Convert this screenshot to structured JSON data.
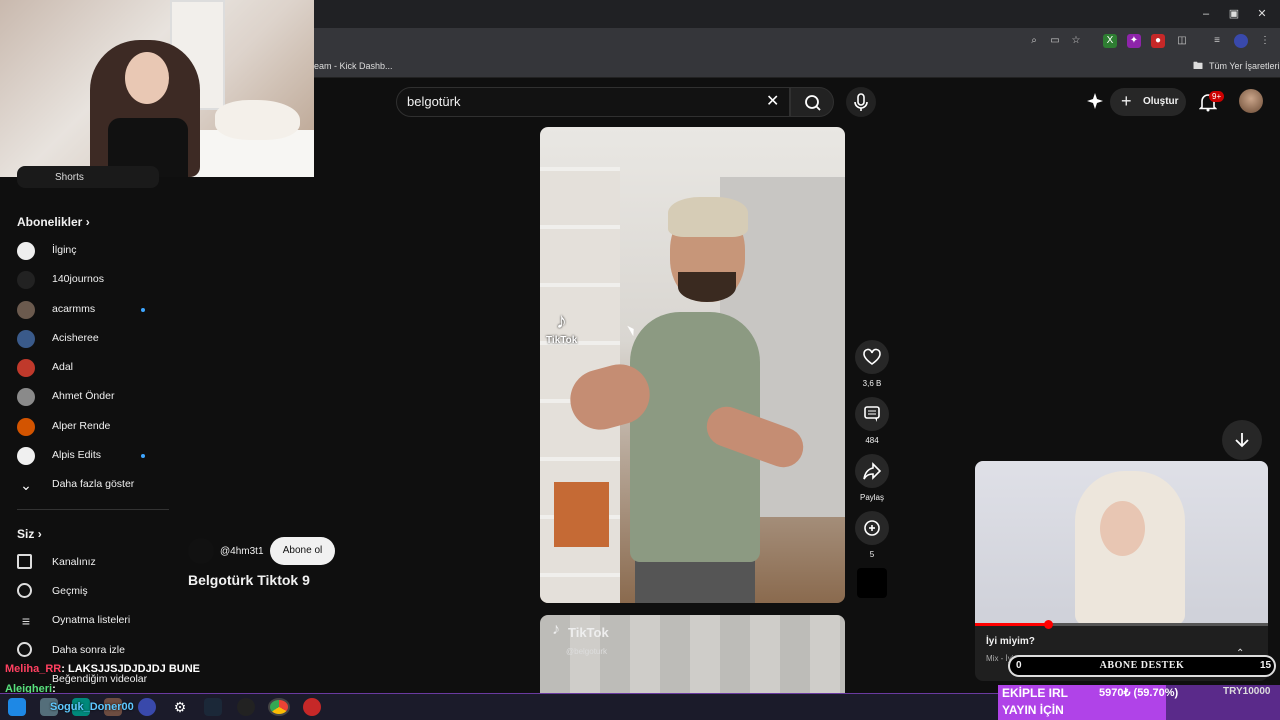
{
  "browser": {
    "bookmark_partial": "eam - Kick Dashb...",
    "all_bookmarks": "Tüm Yer İşaretleri"
  },
  "header": {
    "search_query": "belgotürk",
    "create_label": "Oluştur",
    "notifications_badge": "9+"
  },
  "sidebar": {
    "partial_item": "Shorts",
    "subscriptions_heading": "Abonelikler",
    "subscriptions": [
      {
        "label": "İlginç",
        "new": false,
        "color": "#eeeeee"
      },
      {
        "label": "140journos",
        "new": false,
        "color": "#222222"
      },
      {
        "label": "acarmms",
        "new": true,
        "color": "#6b5a4e"
      },
      {
        "label": "Acisheree",
        "new": false,
        "color": "#3a5a8a"
      },
      {
        "label": "Adal",
        "new": false,
        "color": "#c0392b"
      },
      {
        "label": "Ahmet Önder",
        "new": false,
        "color": "#8a8a8a"
      },
      {
        "label": "Alper Rende",
        "new": false,
        "color": "#d35400"
      },
      {
        "label": "Alpis Edits",
        "new": true,
        "color": "#f0f0f0"
      }
    ],
    "show_more": "Daha fazla göster",
    "you_heading": "Siz",
    "you_items": [
      {
        "label": "Kanalınız"
      },
      {
        "label": "Geçmiş"
      },
      {
        "label": "Oynatma listeleri"
      },
      {
        "label": "Daha sonra izle"
      },
      {
        "label": "Beğendiğim videolar"
      }
    ]
  },
  "short": {
    "channel_handle": "@4hm3t1",
    "subscribe_label": "Abone ol",
    "title": "Belgotürk Tiktok 9",
    "watermark": "TikTok",
    "likes": "3,6 B",
    "comments": "484",
    "share_label": "Paylaş",
    "remix_count": "5"
  },
  "next_short": {
    "watermark": "TikTok",
    "handle": "@belgoturk"
  },
  "mini_player": {
    "title": "İyi miyim?",
    "subtitle": "Mix - İyi miyim?",
    "progress": 0.25
  },
  "overlay": {
    "abone_left": "0",
    "abone_label": "ABONE DESTEK",
    "abone_right": "15",
    "chat": [
      {
        "user": "Meliha_RR",
        "message": ": LAKSJJSJDJDJDJ BUNE"
      },
      {
        "user": "Aleigheri",
        "message": ":"
      }
    ],
    "donation_line1": "EKİPLE IRL",
    "donation_line2": "YAYIN İÇİN",
    "donation_progress": "5970₺ (59.70%)",
    "donation_fraction": 0.597,
    "donation_goal": "TRY10000",
    "taskbar_user": "Soguk_Doner00"
  },
  "colors": {
    "accent_red": "#ff0000",
    "link_blue": "#3ea6ff",
    "donation_purple": "#b043e8"
  }
}
